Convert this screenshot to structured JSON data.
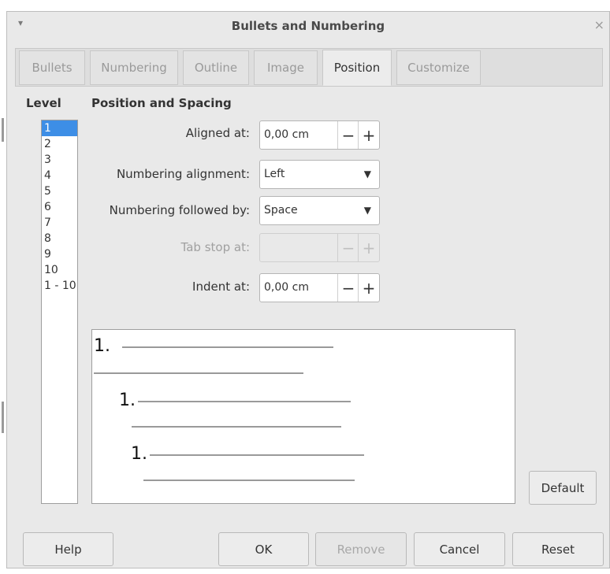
{
  "window": {
    "title": "Bullets and Numbering",
    "menu_glyph": "▾",
    "close_glyph": "×"
  },
  "tabs": [
    {
      "label": "Bullets"
    },
    {
      "label": "Numbering"
    },
    {
      "label": "Outline"
    },
    {
      "label": "Image"
    },
    {
      "label": "Position",
      "active": true
    },
    {
      "label": "Customize"
    }
  ],
  "level": {
    "heading": "Level",
    "items": [
      "1",
      "2",
      "3",
      "4",
      "5",
      "6",
      "7",
      "8",
      "9",
      "10",
      "1 - 10"
    ],
    "selected": "1"
  },
  "position": {
    "heading": "Position and Spacing",
    "aligned_at": {
      "label": "Aligned at:",
      "value": "0,00 cm"
    },
    "numbering_alignment": {
      "label": "Numbering alignment:",
      "value": "Left"
    },
    "numbering_followed_by": {
      "label": "Numbering followed by:",
      "value": "Space"
    },
    "tab_stop_at": {
      "label": "Tab stop at:",
      "value": ""
    },
    "indent_at": {
      "label": "Indent at:",
      "value": "0,00 cm"
    },
    "minus": "−",
    "plus": "+",
    "arrow": "▼"
  },
  "preview": {
    "numbers": [
      "1.",
      "1.",
      "1."
    ]
  },
  "buttons": {
    "default": "Default",
    "help": "Help",
    "ok": "OK",
    "remove": "Remove",
    "cancel": "Cancel",
    "reset": "Reset"
  },
  "colors": {
    "selection": "#3d8ee6",
    "dialog_bg": "#e9e9e9"
  }
}
